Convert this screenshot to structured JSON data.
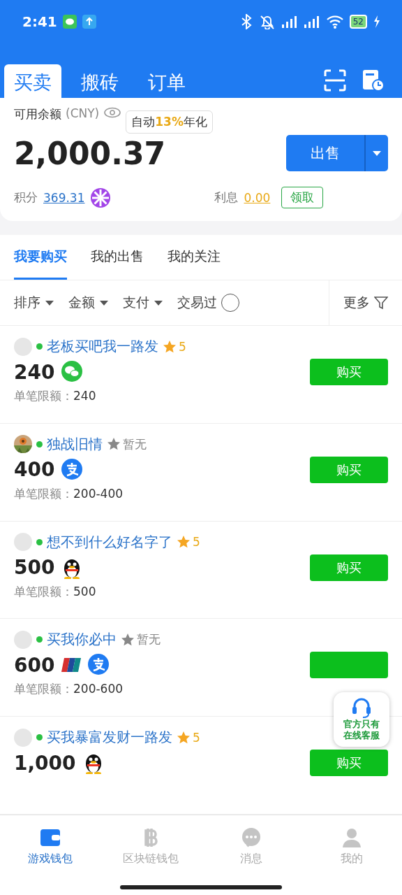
{
  "status_bar": {
    "time": "2:41",
    "battery": "52"
  },
  "top_tabs": [
    {
      "label": "买卖",
      "selected": true
    },
    {
      "label": "搬砖",
      "selected": false
    },
    {
      "label": "订单",
      "selected": false
    }
  ],
  "balance": {
    "label": "可用余额",
    "currency": "(CNY)",
    "promo_prefix": "自动",
    "promo_highlight": "13%",
    "promo_suffix": "年化",
    "amount": "2,000.37",
    "sell_button": "出售",
    "points_label": "积分",
    "points": "369.31",
    "interest_label": "利息",
    "interest": "0.00",
    "claim_button": "领取"
  },
  "market_tabs": [
    {
      "label": "我要购买",
      "selected": true
    },
    {
      "label": "我的出售",
      "selected": false
    },
    {
      "label": "我的关注",
      "selected": false
    }
  ],
  "filters": [
    {
      "kind": "dropdown",
      "label": "排序"
    },
    {
      "kind": "dropdown",
      "label": "金额"
    },
    {
      "kind": "dropdown",
      "label": "支付"
    },
    {
      "kind": "toggle",
      "label": "交易过",
      "checked": false
    },
    {
      "kind": "more",
      "label": "更多"
    }
  ],
  "listings": [
    {
      "avatar": {
        "kind": "blank"
      },
      "online": true,
      "name": "老板买吧我一路发",
      "rated": true,
      "rating": "5",
      "price": "240",
      "payments": [
        {
          "kind": "wechat"
        }
      ],
      "limit_label": "单笔限额：",
      "limit": "240",
      "buy_button": "购买"
    },
    {
      "avatar": {
        "kind": "picture"
      },
      "online": true,
      "name": "独战旧情",
      "rated": false,
      "rating": "暂无",
      "price": "400",
      "payments": [
        {
          "kind": "alipay"
        }
      ],
      "limit_label": "单笔限额：",
      "limit": "200-400",
      "buy_button": "购买"
    },
    {
      "avatar": {
        "kind": "blank"
      },
      "online": true,
      "name": "想不到什么好名字了",
      "rated": true,
      "rating": "5",
      "price": "500",
      "payments": [
        {
          "kind": "qq"
        }
      ],
      "limit_label": "单笔限额：",
      "limit": "500",
      "buy_button": "购买"
    },
    {
      "avatar": {
        "kind": "blank"
      },
      "online": true,
      "name": "买我你必中",
      "rated": false,
      "rating": "暂无",
      "price": "600",
      "payments": [
        {
          "kind": "unionpay"
        },
        {
          "kind": "alipay"
        }
      ],
      "limit_label": "单笔限额：",
      "limit": "200-600"
    },
    {
      "avatar": {
        "kind": "blank"
      },
      "online": true,
      "name": "买我暴富发财一路发",
      "rated": true,
      "rating": "5",
      "price": "1,000",
      "payments": [
        {
          "kind": "qq"
        }
      ],
      "buy_button": "购买"
    }
  ],
  "support_badge": {
    "lines": [
      "官方只有",
      "在线客服"
    ]
  },
  "bottom_nav": [
    {
      "kind": "wallet",
      "label": "游戏钱包",
      "selected": true
    },
    {
      "kind": "bitcoin",
      "label": "区块链钱包",
      "selected": false
    },
    {
      "kind": "chat",
      "label": "消息",
      "selected": false
    },
    {
      "kind": "person",
      "label": "我的",
      "selected": false
    }
  ]
}
